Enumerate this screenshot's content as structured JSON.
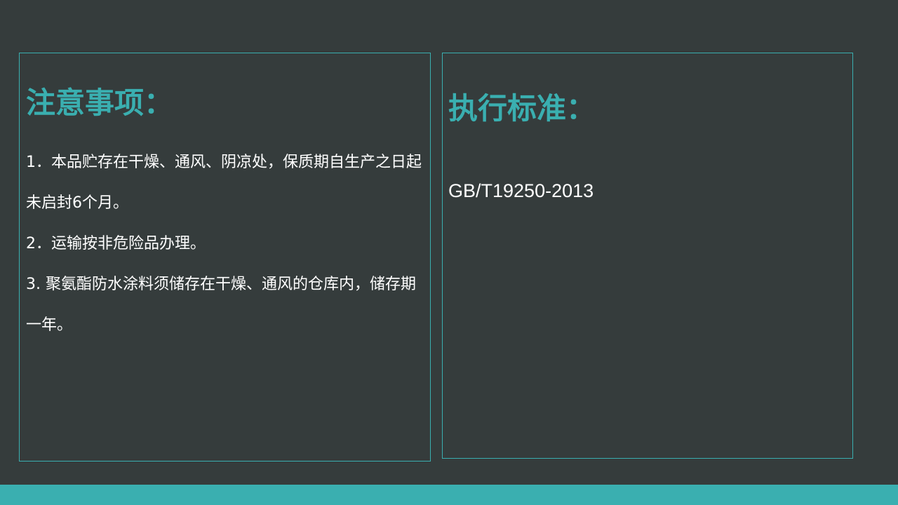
{
  "colors": {
    "background": "#353c3c",
    "accent": "#3aafb0",
    "text": "#ffffff"
  },
  "notes_panel": {
    "heading": "注意事项：",
    "items": [
      "1．本品贮存在干燥、通风、阴凉处，保质期自生产之日起未启封6个月。",
      "2．运输按非危险品办理。",
      "3. 聚氨酯防水涂料须储存在干燥、通风的仓库内，储存期一年。"
    ]
  },
  "standard_panel": {
    "heading": "执行标准：",
    "value": "GB/T19250-2013"
  }
}
